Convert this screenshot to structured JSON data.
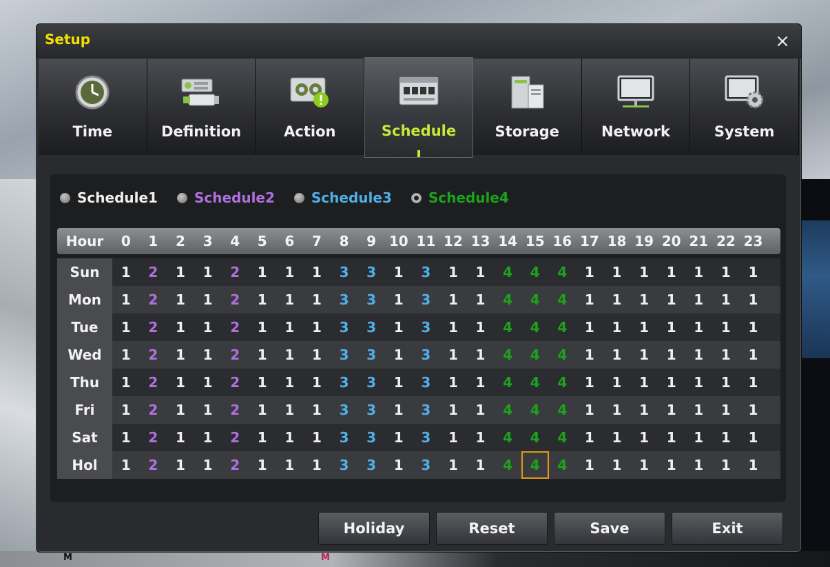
{
  "dialog": {
    "title": "Setup",
    "close_glyph": "×"
  },
  "tabs": [
    {
      "label": "Time",
      "icon": "clock-icon"
    },
    {
      "label": "Definition",
      "icon": "camera-config-icon"
    },
    {
      "label": "Action",
      "icon": "action-alert-icon"
    },
    {
      "label": "Schedule",
      "icon": "schedule-calendar-icon",
      "active": true
    },
    {
      "label": "Storage",
      "icon": "storage-disk-icon"
    },
    {
      "label": "Network",
      "icon": "network-monitor-icon"
    },
    {
      "label": "System",
      "icon": "system-gear-icon"
    }
  ],
  "schedules": [
    {
      "label": "Schedule1",
      "color": "#f0f0f0",
      "selected": false
    },
    {
      "label": "Schedule2",
      "color": "#b070e0",
      "selected": false
    },
    {
      "label": "Schedule3",
      "color": "#4fb0e8",
      "selected": false
    },
    {
      "label": "Schedule4",
      "color": "#1ca31c",
      "selected": true
    }
  ],
  "grid": {
    "corner_label": "Hour",
    "hours": [
      "0",
      "1",
      "2",
      "3",
      "4",
      "5",
      "6",
      "7",
      "8",
      "9",
      "10",
      "11",
      "12",
      "13",
      "14",
      "15",
      "16",
      "17",
      "18",
      "19",
      "20",
      "21",
      "22",
      "23"
    ],
    "days": [
      {
        "day": "Sun",
        "values": [
          1,
          2,
          1,
          1,
          2,
          1,
          1,
          1,
          3,
          3,
          1,
          3,
          1,
          1,
          4,
          4,
          4,
          1,
          1,
          1,
          1,
          1,
          1,
          1
        ]
      },
      {
        "day": "Mon",
        "values": [
          1,
          2,
          1,
          1,
          2,
          1,
          1,
          1,
          3,
          3,
          1,
          3,
          1,
          1,
          4,
          4,
          4,
          1,
          1,
          1,
          1,
          1,
          1,
          1
        ]
      },
      {
        "day": "Tue",
        "values": [
          1,
          2,
          1,
          1,
          2,
          1,
          1,
          1,
          3,
          3,
          1,
          3,
          1,
          1,
          4,
          4,
          4,
          1,
          1,
          1,
          1,
          1,
          1,
          1
        ]
      },
      {
        "day": "Wed",
        "values": [
          1,
          2,
          1,
          1,
          2,
          1,
          1,
          1,
          3,
          3,
          1,
          3,
          1,
          1,
          4,
          4,
          4,
          1,
          1,
          1,
          1,
          1,
          1,
          1
        ]
      },
      {
        "day": "Thu",
        "values": [
          1,
          2,
          1,
          1,
          2,
          1,
          1,
          1,
          3,
          3,
          1,
          3,
          1,
          1,
          4,
          4,
          4,
          1,
          1,
          1,
          1,
          1,
          1,
          1
        ]
      },
      {
        "day": "Fri",
        "values": [
          1,
          2,
          1,
          1,
          2,
          1,
          1,
          1,
          3,
          3,
          1,
          3,
          1,
          1,
          4,
          4,
          4,
          1,
          1,
          1,
          1,
          1,
          1,
          1
        ]
      },
      {
        "day": "Sat",
        "values": [
          1,
          2,
          1,
          1,
          2,
          1,
          1,
          1,
          3,
          3,
          1,
          3,
          1,
          1,
          4,
          4,
          4,
          1,
          1,
          1,
          1,
          1,
          1,
          1
        ]
      },
      {
        "day": "Hol",
        "values": [
          1,
          2,
          1,
          1,
          2,
          1,
          1,
          1,
          3,
          3,
          1,
          3,
          1,
          1,
          4,
          4,
          4,
          1,
          1,
          1,
          1,
          1,
          1,
          1
        ]
      }
    ],
    "cursor": {
      "day": "Hol",
      "hour": "15"
    }
  },
  "buttons": {
    "holiday": "Holiday",
    "reset": "Reset",
    "save": "Save",
    "exit": "Exit"
  },
  "background": {
    "cam_label_1": "M",
    "cam_label_2": "M"
  }
}
